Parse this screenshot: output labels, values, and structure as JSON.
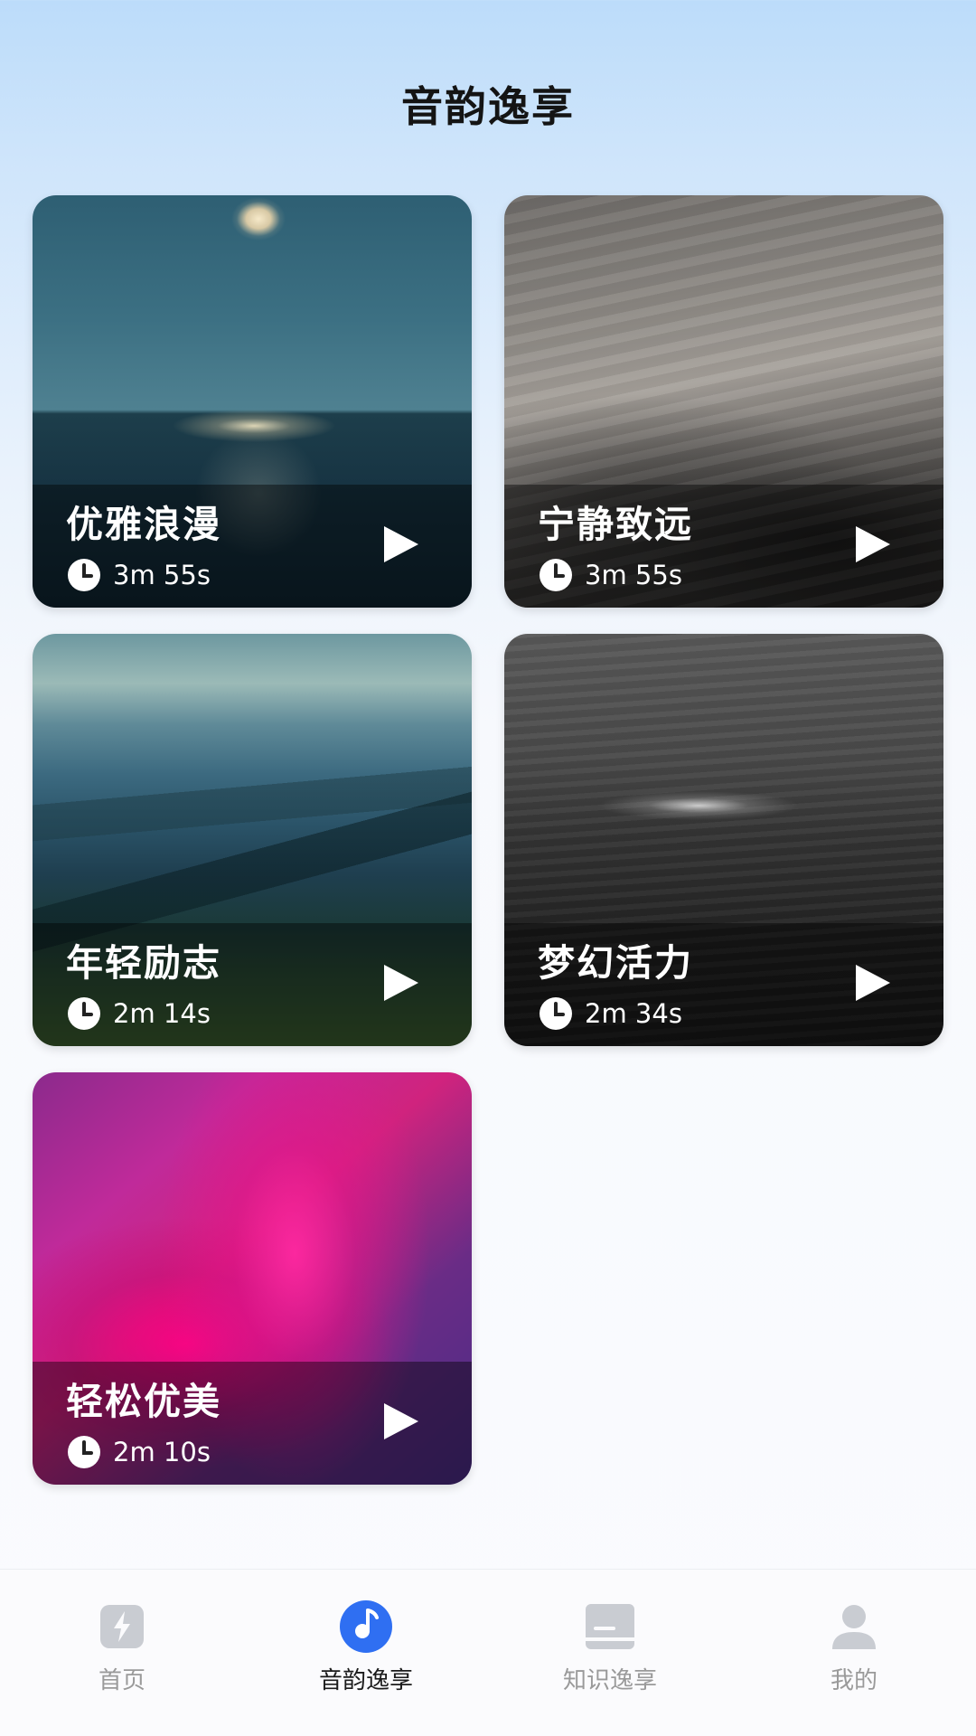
{
  "header": {
    "title": "音韵逸享"
  },
  "tracks": [
    {
      "title": "优雅浪漫",
      "duration": "3m 55s",
      "image": "moonlit-sea"
    },
    {
      "title": "宁静致远",
      "duration": "3m 55s",
      "image": "sand-dunes"
    },
    {
      "title": "年轻励志",
      "duration": "2m 14s",
      "image": "mountain-valley"
    },
    {
      "title": "梦幻活力",
      "duration": "2m 34s",
      "image": "dark-ocean-wave"
    },
    {
      "title": "轻松优美",
      "duration": "2m 10s",
      "image": "pink-purple-gradient"
    }
  ],
  "bottom_nav": {
    "items": [
      {
        "label": "首页",
        "icon": "lightning-icon",
        "active": false
      },
      {
        "label": "音韵逸享",
        "icon": "music-disc-icon",
        "active": true
      },
      {
        "label": "知识逸享",
        "icon": "book-icon",
        "active": false
      },
      {
        "label": "我的",
        "icon": "user-icon",
        "active": false
      }
    ],
    "active_color": "#2f6ff2",
    "inactive_color": "#c9ccd2"
  }
}
